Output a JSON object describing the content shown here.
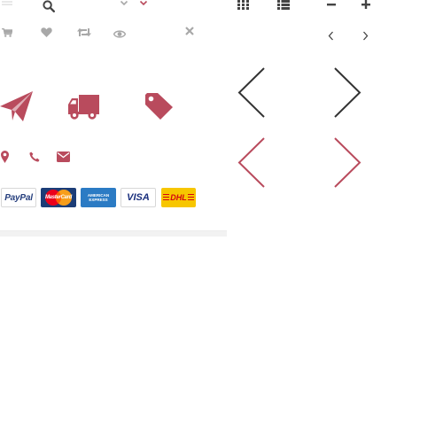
{
  "colors": {
    "accent": "#b94b5d",
    "gray": "#a8a8a8",
    "dark": "#444444",
    "lightgray": "#e2e2e2"
  },
  "top_row": {
    "icons": [
      "menu-icon",
      "search-icon",
      "chevron-down-icon",
      "chevron-down-accent-icon",
      "grid-view-icon",
      "list-view-icon",
      "minus-icon",
      "plus-icon"
    ]
  },
  "action_row": {
    "icons": [
      "cart-icon",
      "heart-icon",
      "compare-icon",
      "eye-icon",
      "close-icon",
      "chevron-left-icon",
      "chevron-right-icon"
    ]
  },
  "feature_icons": [
    "paper-plane-icon",
    "truck-icon",
    "tag-icon"
  ],
  "arrows": [
    "large-arrow-left-dark",
    "large-arrow-right-dark",
    "large-arrow-left-accent",
    "large-arrow-right-accent"
  ],
  "contact_icons": [
    "map-marker-icon",
    "phone-icon",
    "envelope-icon"
  ],
  "payments": {
    "paypal": "PayPal",
    "mastercard": "MasterCard",
    "amex_line1": "AMERICAN",
    "amex_line2": "EXPRESS",
    "visa": "VISA",
    "dhl": "DHL"
  }
}
